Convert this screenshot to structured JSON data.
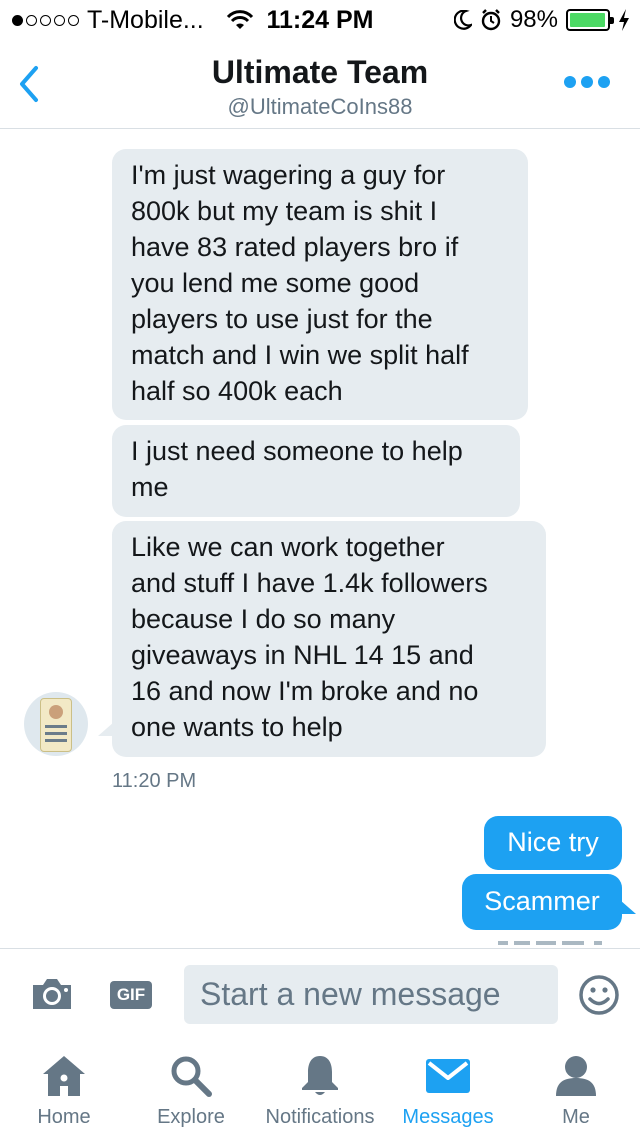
{
  "status_bar": {
    "carrier": "T-Mobile...",
    "time": "11:24 PM",
    "battery": "98%",
    "battery_level": 0.98,
    "signal_bars": 1
  },
  "header": {
    "title": "Ultimate Team",
    "handle": "@UltimateCoIns88"
  },
  "messages": [
    {
      "direction": "received",
      "lines": [
        "I'm just wagering a guy for",
        "800k but my team is shit I",
        "have 83 rated players bro if",
        "you lend me some good",
        "players to use just for the",
        "match and I win we split half",
        "half so 400k each"
      ]
    },
    {
      "direction": "received",
      "lines": [
        "I just need someone to help",
        "me"
      ]
    },
    {
      "direction": "received",
      "lines": [
        "Like we can work together",
        "and stuff I have 1.4k followers",
        "because I do so many",
        "giveaways in NHL 14 15 and",
        "16 and now I'm broke and no",
        "one wants to help"
      ]
    },
    {
      "direction": "sent",
      "text": "Nice try"
    },
    {
      "direction": "sent",
      "text": "Scammer"
    }
  ],
  "timestamp": "11:20 PM",
  "compose": {
    "placeholder": "Start a new message",
    "gif_label": "GIF"
  },
  "tabs": [
    {
      "label": "Home",
      "icon": "home-icon",
      "active": false
    },
    {
      "label": "Explore",
      "icon": "search-icon",
      "active": false
    },
    {
      "label": "Notifications",
      "icon": "bell-icon",
      "active": false
    },
    {
      "label": "Messages",
      "icon": "envelope-icon",
      "active": true
    },
    {
      "label": "Me",
      "icon": "person-icon",
      "active": false
    }
  ],
  "colors": {
    "accent": "#1da1f2",
    "received_bubble": "#e6ecf0",
    "muted_text": "#657786",
    "battery_green": "#4cd964"
  }
}
